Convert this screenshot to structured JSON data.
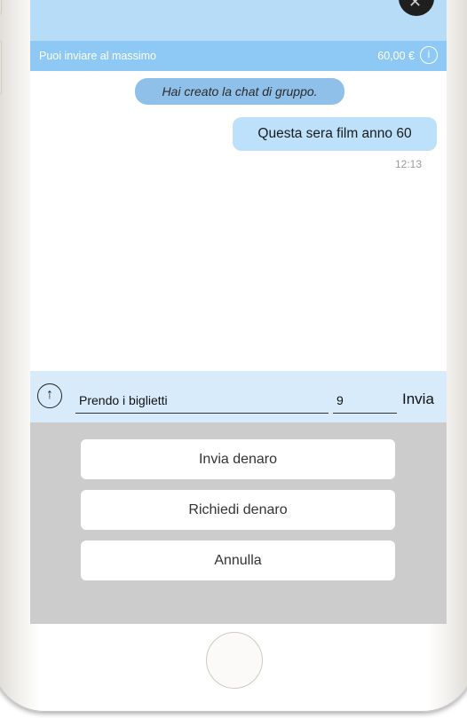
{
  "limit_bar": {
    "label": "Puoi inviare al massimo",
    "amount": "60,00 €",
    "info_icon": "i"
  },
  "chat": {
    "system_message": "Hai creato la chat di gruppo.",
    "messages": [
      {
        "text": "Questa sera film anno 60",
        "time": "12:13"
      }
    ]
  },
  "composer": {
    "upload_icon": "↑",
    "message_value": "Prendo i biglietti",
    "amount_value": "9",
    "send_label": "Invia"
  },
  "action_sheet": {
    "send_money": "Invia denaro",
    "request_money": "Richiedi denaro",
    "cancel": "Annulla"
  },
  "colors": {
    "accent_yellow": "#f2c22a",
    "header_blue": "#8dc9f4",
    "bubble_blue": "#bde0fb"
  }
}
